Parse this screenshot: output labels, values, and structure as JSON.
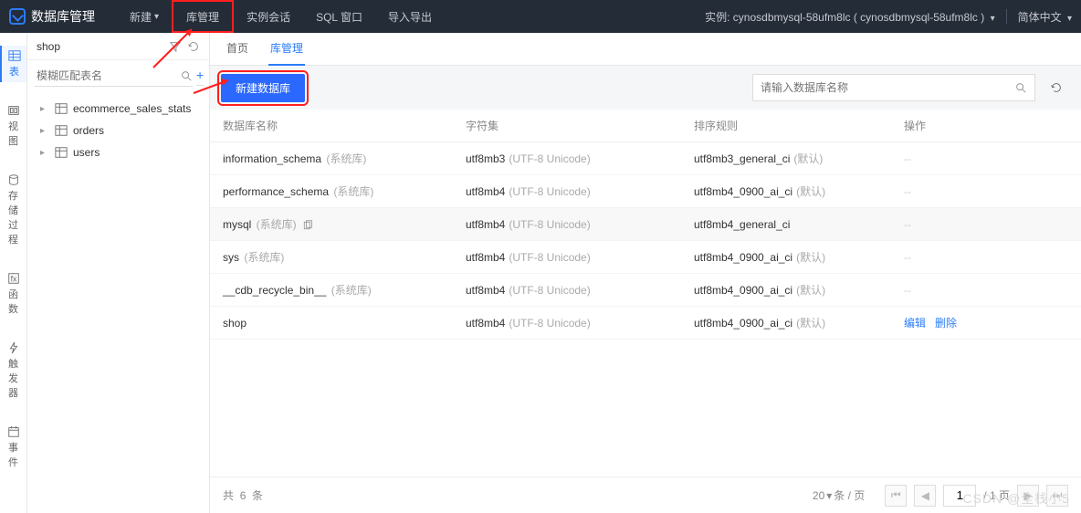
{
  "top": {
    "app_title": "数据库管理",
    "menu": {
      "new": "新建",
      "db_mgmt": "库管理",
      "sessions": "实例会话",
      "sql_window": "SQL 窗口",
      "import_export": "导入导出"
    },
    "instance_label": "实例: cynosdbmysql-58ufm8lc ( cynosdbmysql-58ufm8lc )",
    "language": "简体中文"
  },
  "farleft": {
    "tables": "表",
    "views": "视\n图",
    "procs": "存\n储\n过\n程",
    "funcs": "函\n数",
    "triggers": "触\n发\n器",
    "events": "事\n件"
  },
  "sidebar": {
    "db_title": "shop",
    "search_placeholder": "模糊匹配表名",
    "items": [
      {
        "label": "ecommerce_sales_stats"
      },
      {
        "label": "orders"
      },
      {
        "label": "users"
      }
    ]
  },
  "tabs": {
    "home": "首页",
    "db_mgmt": "库管理"
  },
  "toolbar": {
    "create_db": "新建数据库",
    "search_placeholder": "请输入数据库名称"
  },
  "table": {
    "columns": {
      "name": "数据库名称",
      "charset": "字符集",
      "collation": "排序规则",
      "ops": "操作"
    },
    "syslabel": "(系统库)",
    "charset_note": "(UTF-8 Unicode)",
    "default_note": "(默认)",
    "dash": "--",
    "edit": "编辑",
    "delete": "删除",
    "rows": [
      {
        "name": "information_schema",
        "sys": true,
        "charset": "utf8mb3",
        "collation": "utf8mb3_general_ci",
        "col_def": true,
        "ops": "dash"
      },
      {
        "name": "performance_schema",
        "sys": true,
        "charset": "utf8mb4",
        "collation": "utf8mb4_0900_ai_ci",
        "col_def": true,
        "ops": "dash"
      },
      {
        "name": "mysql",
        "sys": true,
        "charset": "utf8mb4",
        "collation": "utf8mb4_general_ci",
        "col_def": false,
        "ops": "dash",
        "hover": true,
        "copy": true
      },
      {
        "name": "sys",
        "sys": true,
        "charset": "utf8mb4",
        "collation": "utf8mb4_0900_ai_ci",
        "col_def": true,
        "ops": "dash"
      },
      {
        "name": "__cdb_recycle_bin__",
        "sys": true,
        "charset": "utf8mb4",
        "collation": "utf8mb4_0900_ai_ci",
        "col_def": true,
        "ops": "dash"
      },
      {
        "name": "shop",
        "sys": false,
        "charset": "utf8mb4",
        "collation": "utf8mb4_0900_ai_ci",
        "col_def": true,
        "ops": "links"
      }
    ]
  },
  "footer": {
    "total_prefix": "共",
    "total_count": "6",
    "total_suffix": "条",
    "page_size": "20",
    "page_size_suffix": "条 / 页",
    "page_current": "1",
    "page_total": "/ 1 页"
  },
  "watermark": "CSDN @全栈小5"
}
